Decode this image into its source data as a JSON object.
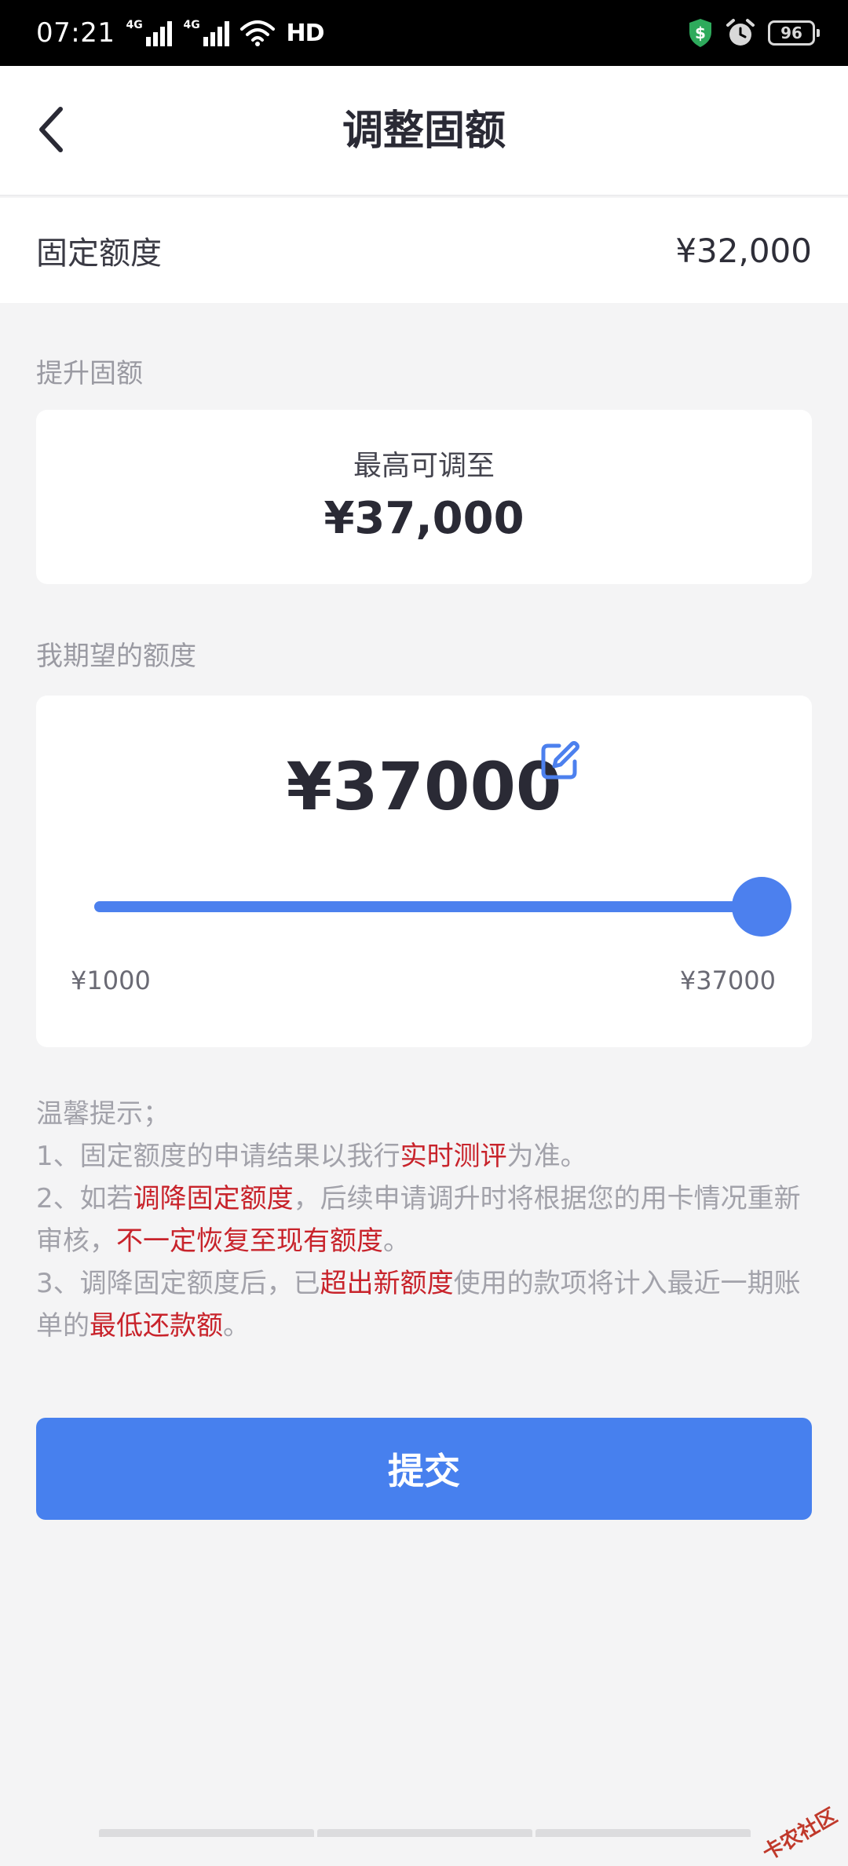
{
  "status_bar": {
    "time": "07:21",
    "network_1": "4G",
    "network_2": "4G",
    "hd": "HD",
    "battery": "96"
  },
  "nav": {
    "title": "调整固额"
  },
  "fixed_limit": {
    "label": "固定额度",
    "value": "¥32,000"
  },
  "raise": {
    "section_label": "提升固额",
    "max_caption": "最高可调至",
    "max_amount": "¥37,000"
  },
  "expect": {
    "section_label": "我期望的额度",
    "amount": "¥37000",
    "slider_min": "¥1000",
    "slider_max": "¥37000",
    "slider_value_fraction": 1.0
  },
  "tips": {
    "title": "温馨提示；",
    "line1_a": "1、固定额度的申请结果以我行",
    "line1_hl": "实时测评",
    "line1_b": "为准。",
    "line2_a": "2、如若",
    "line2_hl1": "调降固定额度",
    "line2_b": "，后续申请调升时将根据您的用卡情况重新审核，",
    "line2_hl2": "不一定恢复至现有额度",
    "line2_c": "。",
    "line3_a": "3、调降固定额度后，已",
    "line3_hl1": "超出新额度",
    "line3_b": "使用的款项将计入最近一期账单的",
    "line3_hl2": "最低还款额",
    "line3_c": "。"
  },
  "submit": {
    "label": "提交"
  },
  "watermark": "卡农社区",
  "colors": {
    "accent": "#4780ee",
    "highlight": "#c8232b",
    "background": "#f4f4f5"
  }
}
